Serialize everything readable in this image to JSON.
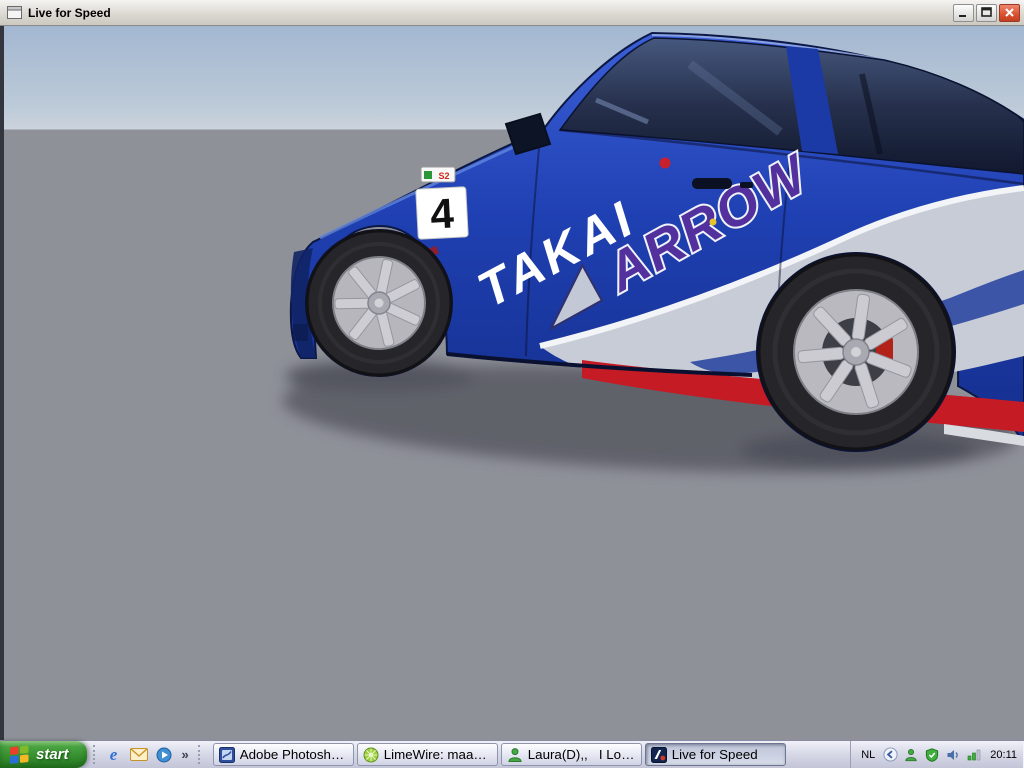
{
  "window": {
    "title": "Live for Speed"
  },
  "game": {
    "car": {
      "race_number": "4",
      "class_sticker": "S2",
      "door_sponsor": "TAKAI",
      "quarter_sponsor": "ARROW"
    },
    "colors": {
      "sky_top": "#a3b7d1",
      "sky_bottom": "#cbd3dc",
      "ground": "#8f9199",
      "body_blue": "#1f40b2",
      "livery_red": "#c41b24",
      "livery_silver": "#c7ccd6",
      "arrow_purple": "#52309e"
    }
  },
  "taskbar": {
    "start_label": "start",
    "quick_launch": {
      "ie_glyph": "e",
      "overflow_chevron": "»"
    },
    "tasks": [
      {
        "label": "Adobe Photoshop E...",
        "active": false
      },
      {
        "label": "LimeWire: maakt op...",
        "active": false
      },
      {
        "label": "Laura(D),,   I Lov...",
        "active": false
      },
      {
        "label": "Live for Speed",
        "active": true
      }
    ],
    "tray": {
      "language": "NL",
      "clock": "20:11"
    }
  }
}
